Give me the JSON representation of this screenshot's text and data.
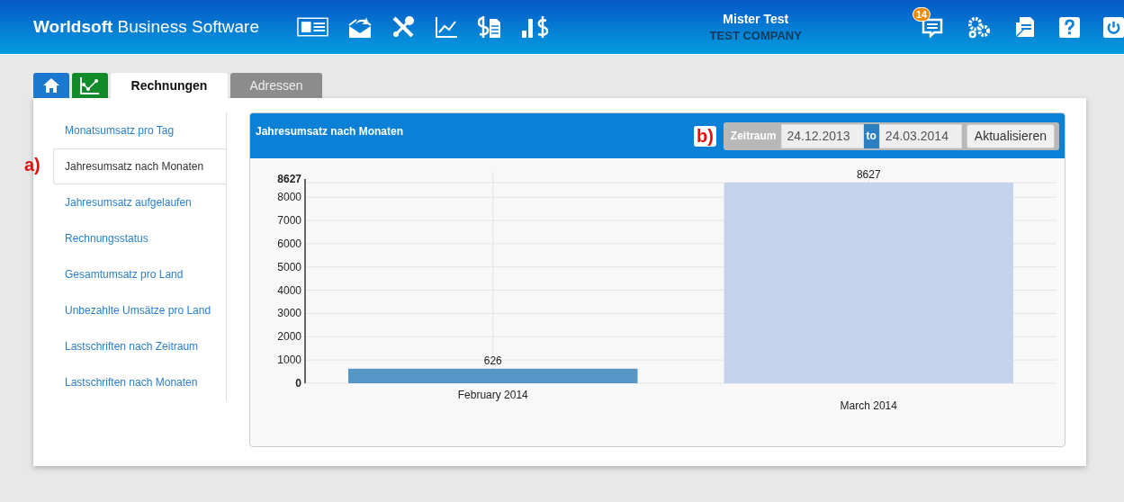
{
  "header": {
    "brand_bold": "Worldsoft",
    "brand_rest": "Business Software",
    "user_name": "Mister Test",
    "company": "TEST COMPANY",
    "message_count": "14"
  },
  "tabs": [
    {
      "kind": "home",
      "selected": false
    },
    {
      "kind": "chart",
      "selected": false
    },
    {
      "kind": "text",
      "label": "Rechnungen",
      "selected": true
    },
    {
      "kind": "text",
      "label": "Adressen",
      "selected": false
    }
  ],
  "sidebar": {
    "items": [
      {
        "label": "Monatsumsatz pro Tag",
        "selected": false
      },
      {
        "label": "Jahresumsatz nach Monaten",
        "selected": true,
        "marker": "a)"
      },
      {
        "label": "Jahresumsatz aufgelaufen",
        "selected": false
      },
      {
        "label": "Rechnungsstatus",
        "selected": false
      },
      {
        "label": "Gesamtumsatz pro Land",
        "selected": false
      },
      {
        "label": "Unbezahlte Umsätze pro Land",
        "selected": false
      },
      {
        "label": "Lastschriften nach Zeitraum",
        "selected": false
      },
      {
        "label": "Lastschriften nach Monaten",
        "selected": false
      }
    ]
  },
  "panel": {
    "title": "Jahresumsatz nach Monaten",
    "marker": "b)",
    "range_label": "Zeitraum",
    "from": "24.12.2013",
    "to_label": "to",
    "to": "24.03.2014",
    "button": "Aktualisieren",
    "chart_data": {
      "type": "bar",
      "categories": [
        "February 2014",
        "March 2014"
      ],
      "series": [
        {
          "color": "#5596c6",
          "values": [
            626,
            null
          ]
        },
        {
          "color": "#c3d4ec",
          "values": [
            null,
            8627
          ]
        }
      ],
      "ylim": [
        0,
        8627
      ],
      "yticks": [
        0,
        1000,
        2000,
        3000,
        4000,
        5000,
        6000,
        7000,
        8000,
        8627
      ],
      "data_labels": true,
      "grid": true
    }
  }
}
